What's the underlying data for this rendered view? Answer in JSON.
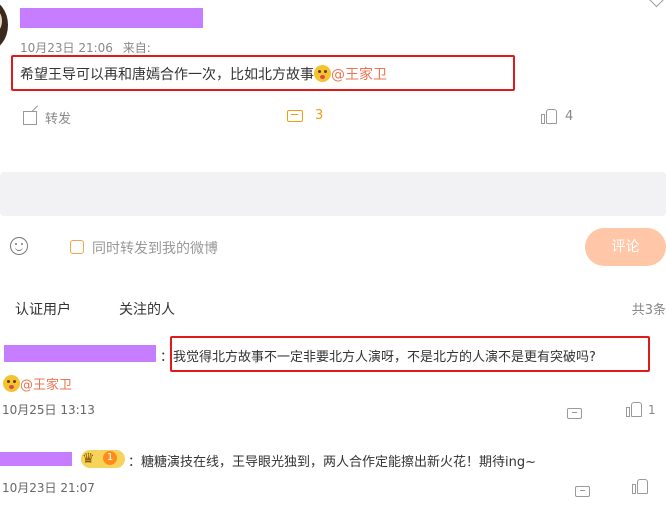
{
  "post": {
    "timestamp": "10月23日 21:06",
    "source_label": "来自:",
    "text": "希望王导可以再和唐嫣合作一次，比如北方故事",
    "mention": "@王家卫",
    "actions": {
      "forward_label": "转发",
      "comment_count": "3",
      "like_count": "4"
    }
  },
  "composer": {
    "also_forward_label": "同时转发到我的微博",
    "submit_label": "评论"
  },
  "comment_tabs": {
    "tab1": "认证用户",
    "tab2": "关注的人",
    "total": "共3条"
  },
  "comments": [
    {
      "text": "：我觉得北方故事不一定非要北方人演呀，不是北方的人演不是更有突破吗?",
      "mention": "@王家卫",
      "timestamp": "10月25日 13:13",
      "like_count": "1"
    },
    {
      "text": "：糖糖演技在线，王导眼光独到，两人合作定能擦出新火花！期待ing~",
      "timestamp": "10月23日 21:07",
      "badge_level": "1"
    }
  ],
  "colors": {
    "accent_orange": "#f39c12",
    "mention": "#eb7350",
    "highlight_box": "#e0191a",
    "redaction": "#c77dff",
    "submit_bg": "#ffc6a8"
  }
}
